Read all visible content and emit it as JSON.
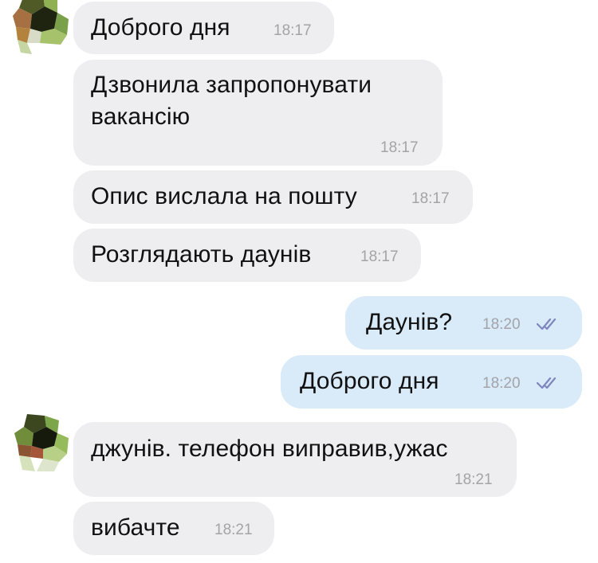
{
  "messages": [
    {
      "direction": "incoming",
      "text": "Доброго дня",
      "time": "18:17"
    },
    {
      "direction": "incoming",
      "text_lines": [
        "Дзвонила запропонувати",
        "вакансію"
      ],
      "time": "18:17"
    },
    {
      "direction": "incoming",
      "text": "Опис вислала на пошту",
      "time": "18:17"
    },
    {
      "direction": "incoming",
      "text": "Розглядають даунів",
      "time": "18:17"
    },
    {
      "direction": "outgoing",
      "text": "Даунів?",
      "time": "18:20",
      "status": "read"
    },
    {
      "direction": "outgoing",
      "text": "Доброго дня",
      "time": "18:20",
      "status": "read"
    },
    {
      "direction": "incoming",
      "text": "джунів. телефон виправив,ужас",
      "time": "18:21"
    },
    {
      "direction": "incoming",
      "text": "вибачте",
      "time": "18:21"
    }
  ],
  "colors": {
    "incoming_bubble": "#eeeef0",
    "outgoing_bubble": "#d9eaf9",
    "timestamp": "#a3a3a8",
    "read_check": "#7f86bd"
  },
  "icons": {
    "avatar": "pixelated-avatar-icon",
    "read_status": "double-check-icon"
  }
}
